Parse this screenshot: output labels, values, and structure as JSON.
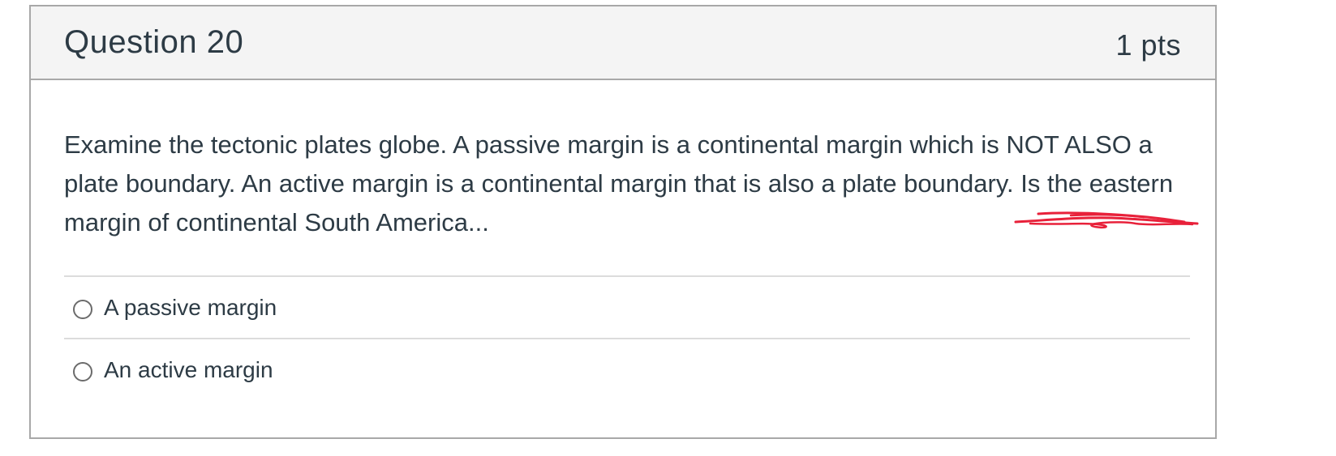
{
  "question": {
    "title": "Question 20",
    "points": "1 pts",
    "text": "Examine the tectonic plates globe. A passive margin is a continental margin which is NOT ALSO a plate boundary. An active margin is a continental margin that is also a plate boundary. Is the eastern margin of continental South America..."
  },
  "answers": [
    {
      "label": "A passive margin",
      "selected": false
    },
    {
      "label": "An active margin",
      "selected": false
    }
  ],
  "colors": {
    "annotation": "#e8213a",
    "header_bg": "#f4f4f4",
    "border": "#a8a8a8",
    "text": "#2d3b45"
  }
}
